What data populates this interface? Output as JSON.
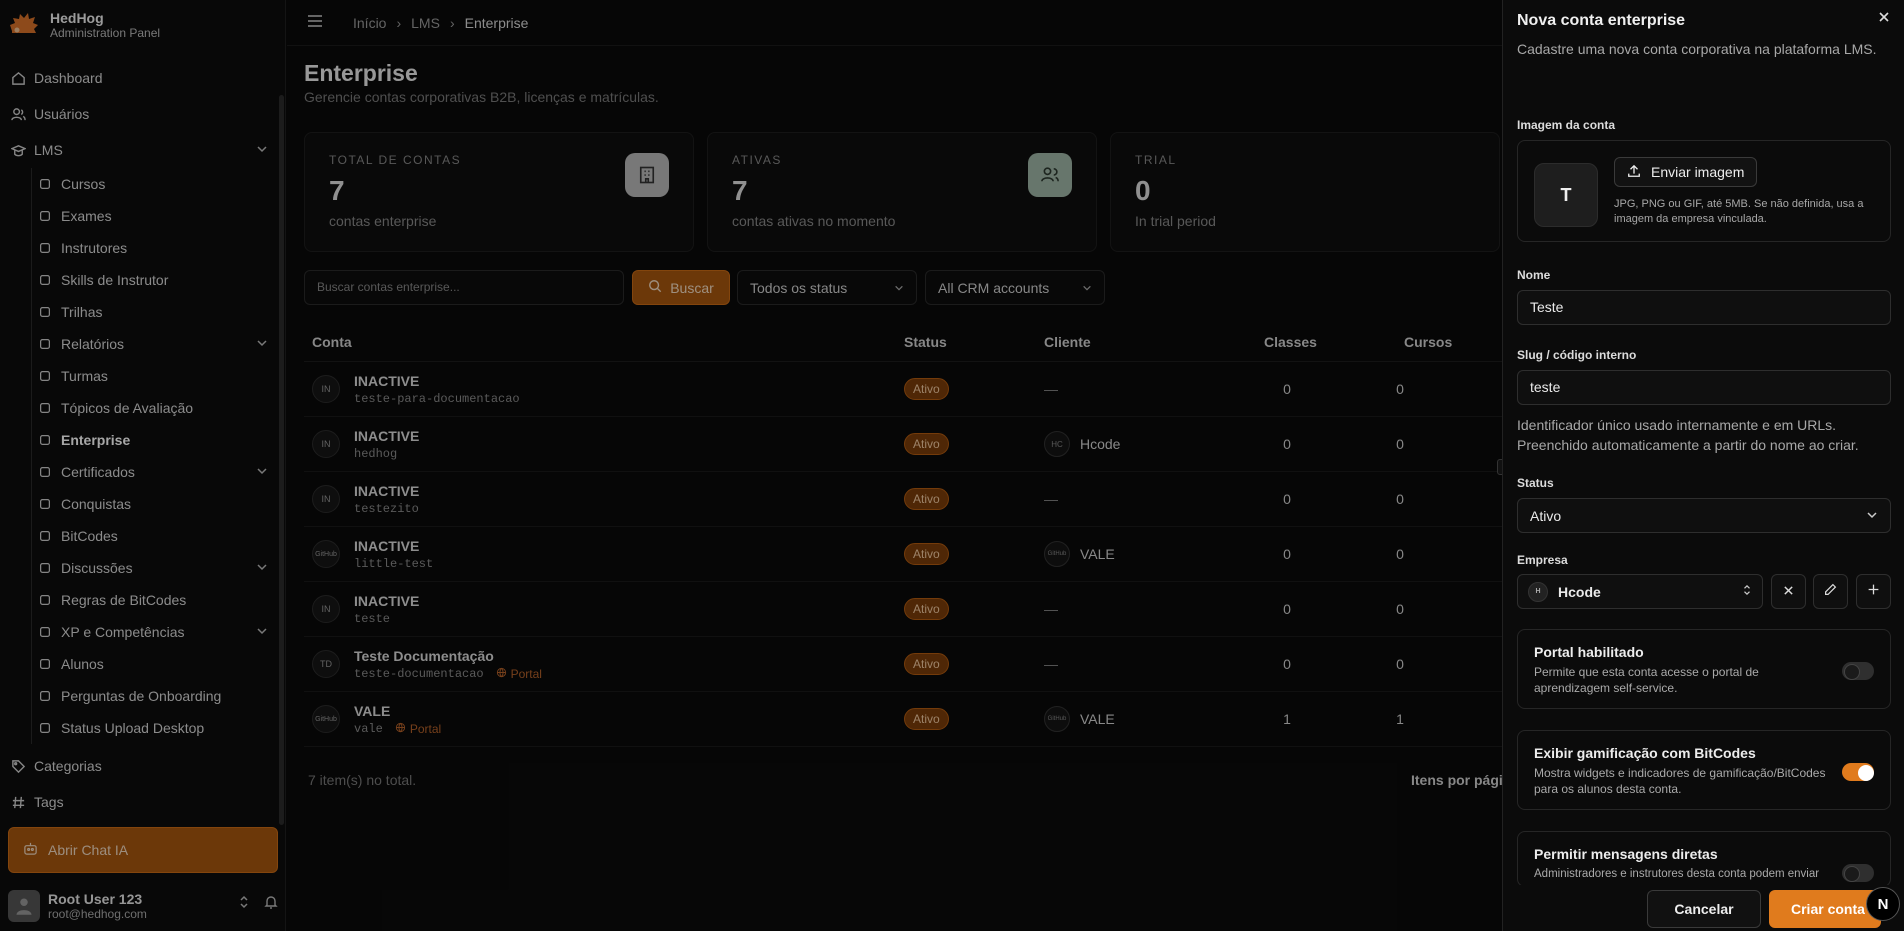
{
  "brand": {
    "name": "HedHog",
    "subtitle": "Administration Panel"
  },
  "sidebar": {
    "top": [
      {
        "label": "Dashboard",
        "icon": "home-icon"
      },
      {
        "label": "Usuários",
        "icon": "users-icon"
      },
      {
        "label": "LMS",
        "icon": "graduation-cap-icon"
      }
    ],
    "lms_items": [
      {
        "label": "Cursos",
        "icon": "book-icon",
        "expandable": false
      },
      {
        "label": "Exames",
        "icon": "clipboard-icon",
        "expandable": false
      },
      {
        "label": "Instrutores",
        "icon": "user-cog-icon",
        "expandable": false
      },
      {
        "label": "Skills de Instrutor",
        "icon": "sparkles-icon",
        "expandable": false
      },
      {
        "label": "Trilhas",
        "icon": "route-icon",
        "expandable": false
      },
      {
        "label": "Relatórios",
        "icon": "folder-icon",
        "expandable": true
      },
      {
        "label": "Turmas",
        "icon": "users-round-icon",
        "expandable": false
      },
      {
        "label": "Tópicos de Avaliação",
        "icon": "list-checks-icon",
        "expandable": false
      },
      {
        "label": "Enterprise",
        "icon": "building-icon",
        "expandable": false,
        "active": true
      },
      {
        "label": "Certificados",
        "icon": "award-icon",
        "expandable": true
      },
      {
        "label": "Conquistas",
        "icon": "trophy-icon",
        "expandable": false
      },
      {
        "label": "BitCodes",
        "icon": "coin-icon",
        "expandable": false
      },
      {
        "label": "Discussões",
        "icon": "message-icon",
        "expandable": true
      },
      {
        "label": "Regras de BitCodes",
        "icon": "scroll-icon",
        "expandable": false
      },
      {
        "label": "XP e Competências",
        "icon": "zap-icon",
        "expandable": true
      },
      {
        "label": "Alunos",
        "icon": "user-icon",
        "expandable": false
      },
      {
        "label": "Perguntas de Onboarding",
        "icon": "clipboard-list-icon",
        "expandable": false
      },
      {
        "label": "Status Upload Desktop",
        "icon": "upload-icon",
        "expandable": false
      }
    ],
    "bottom": [
      {
        "label": "Categorias",
        "icon": "tag-icon"
      },
      {
        "label": "Tags",
        "icon": "hash-icon"
      }
    ],
    "chat_button": "Abrir Chat IA",
    "user": {
      "name": "Root User 123",
      "email": "root@hedhog.com"
    }
  },
  "breadcrumb": {
    "items": [
      "Início",
      "LMS",
      "Enterprise"
    ]
  },
  "page": {
    "title": "Enterprise",
    "subtitle": "Gerencie contas corporativas B2B, licenças e matrículas."
  },
  "stats": [
    {
      "label": "TOTAL DE CONTAS",
      "value": "7",
      "desc": "contas enterprise",
      "icon": "building-icon",
      "color": "#b9b9b9"
    },
    {
      "label": "ATIVAS",
      "value": "7",
      "desc": "contas ativas no momento",
      "icon": "users-icon",
      "color": "#9fb5a6"
    },
    {
      "label": "TRIAL",
      "value": "0",
      "desc": "In trial period",
      "icon": "calendar-icon",
      "color": "#c8a98a"
    }
  ],
  "filters": {
    "search_placeholder": "Buscar contas enterprise...",
    "search_button": "Buscar",
    "status_select": "Todos os status",
    "crm_select": "All CRM accounts"
  },
  "table": {
    "headers": {
      "conta": "Conta",
      "status": "Status",
      "cliente": "Cliente",
      "classes": "Classes",
      "cursos": "Cursos"
    },
    "rows": [
      {
        "avatar": "IN",
        "name": "INACTIVE",
        "slug": "teste-para-documentacao",
        "portal": "",
        "status": "Ativo",
        "client": "—",
        "client_avatar": "",
        "classes": "0",
        "cursos": "0"
      },
      {
        "avatar": "IN",
        "name": "INACTIVE",
        "slug": "hedhog",
        "portal": "",
        "status": "Ativo",
        "client": "Hcode",
        "client_avatar": "HC",
        "classes": "0",
        "cursos": "0"
      },
      {
        "avatar": "IN",
        "name": "INACTIVE",
        "slug": "testezito",
        "portal": "",
        "status": "Ativo",
        "client": "—",
        "client_avatar": "",
        "classes": "0",
        "cursos": "0"
      },
      {
        "avatar": "GitHub",
        "name": "INACTIVE",
        "slug": "little-test",
        "portal": "",
        "status": "Ativo",
        "client": "VALE",
        "client_avatar": "GitHub",
        "classes": "0",
        "cursos": "0"
      },
      {
        "avatar": "IN",
        "name": "INACTIVE",
        "slug": "teste",
        "portal": "",
        "status": "Ativo",
        "client": "—",
        "client_avatar": "",
        "classes": "0",
        "cursos": "0"
      },
      {
        "avatar": "TD",
        "name": "Teste Documentação",
        "slug": "teste-documentacao",
        "portal": "Portal",
        "status": "Ativo",
        "client": "—",
        "client_avatar": "",
        "classes": "0",
        "cursos": "0"
      },
      {
        "avatar": "GitHub",
        "name": "VALE",
        "slug": "vale",
        "portal": "Portal",
        "status": "Ativo",
        "client": "VALE",
        "client_avatar": "GitHub",
        "classes": "1",
        "cursos": "1"
      }
    ],
    "total": "7 item(s) no total.",
    "per_page_label": "Itens por pági"
  },
  "drawer": {
    "title": "Nova conta enterprise",
    "subtitle": "Cadastre uma nova conta corporativa na plataforma LMS.",
    "image_label": "Imagem da conta",
    "image_letter": "T",
    "upload_button": "Enviar imagem",
    "image_hint": "JPG, PNG ou GIF, até 5MB. Se não definida, usa a imagem da empresa vinculada.",
    "name_label": "Nome",
    "name_value": "Teste",
    "slug_label": "Slug / código interno",
    "slug_value": "teste",
    "slug_help_1": "Identificador único usado internamente e em URLs.",
    "slug_help_2": "Preenchido automaticamente a partir do nome ao criar.",
    "status_label": "Status",
    "status_value": "Ativo",
    "company_label": "Empresa",
    "company_avatar": "H",
    "company_value": "Hcode",
    "cards": [
      {
        "title": "Portal habilitado",
        "desc": "Permite que esta conta acesse o portal de aprendizagem self-service.",
        "on": false
      },
      {
        "title": "Exibir gamificação com BitCodes",
        "desc": "Mostra widgets e indicadores de gamificação/BitCodes para os alunos desta conta.",
        "on": true
      },
      {
        "title": "Permitir mensagens diretas",
        "desc": "Administradores e instrutores desta conta podem enviar",
        "on": false
      }
    ],
    "cancel_button": "Cancelar",
    "create_button": "Criar conta",
    "n_badge": "N"
  },
  "colors": {
    "accent": "#e07b1d",
    "accent_dark": "#a6570f",
    "background": "#0a0a0a"
  }
}
